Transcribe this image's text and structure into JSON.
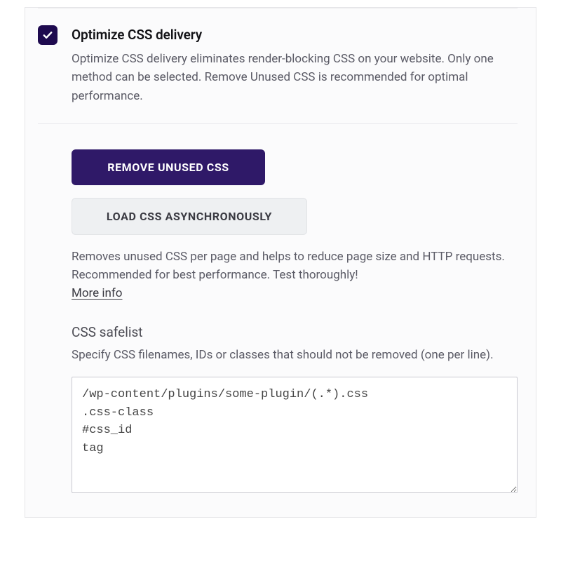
{
  "setting": {
    "title": "Optimize CSS delivery",
    "description": "Optimize CSS delivery eliminates render-blocking CSS on your website. Only one method can be selected. Remove Unused CSS is recommended for optimal performance.",
    "checked": true
  },
  "options": {
    "primary_label": "REMOVE UNUSED CSS",
    "secondary_label": "LOAD CSS ASYNCHRONOUSLY",
    "description": "Removes unused CSS per page and helps to reduce page size and HTTP requests. Recommended for best performance. Test thoroughly!",
    "more_info": "More info"
  },
  "safelist": {
    "title": "CSS safelist",
    "description": "Specify CSS filenames, IDs or classes that should not be removed (one per line).",
    "value": "/wp-content/plugins/some-plugin/(.*).css\n.css-class\n#css_id\ntag"
  }
}
